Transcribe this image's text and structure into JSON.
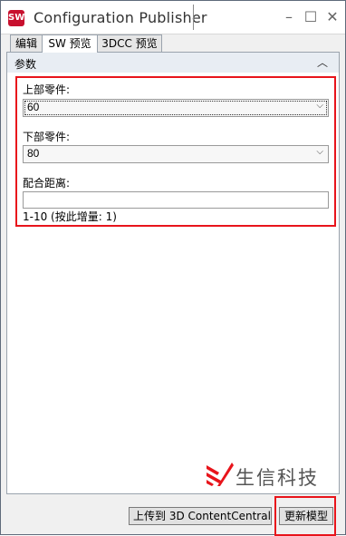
{
  "window": {
    "title": "Configuration Publisher",
    "app_icon": "SW",
    "controls": {
      "minimize": "–",
      "maximize": "☐",
      "close": "✕"
    }
  },
  "tabs": [
    {
      "label": "编辑",
      "active": false
    },
    {
      "label": "SW 预览",
      "active": true
    },
    {
      "label": "3DCC 预览",
      "active": false
    }
  ],
  "group": {
    "title": "参数",
    "collapse_glyph": "︿"
  },
  "params": {
    "upper_part": {
      "label": "上部零件:",
      "value": "60"
    },
    "lower_part": {
      "label": "下部零件:",
      "value": "80"
    },
    "mate_distance": {
      "label": "配合距离:",
      "value": "",
      "hint": "1-10 (按此增量: 1)"
    }
  },
  "watermark": {
    "text": "生信科技"
  },
  "footer": {
    "upload_label": "上传到 3D ContentCentral",
    "update_label": "更新模型"
  },
  "colors": {
    "highlight": "#e8141b",
    "brand_red": "#c8102e"
  }
}
